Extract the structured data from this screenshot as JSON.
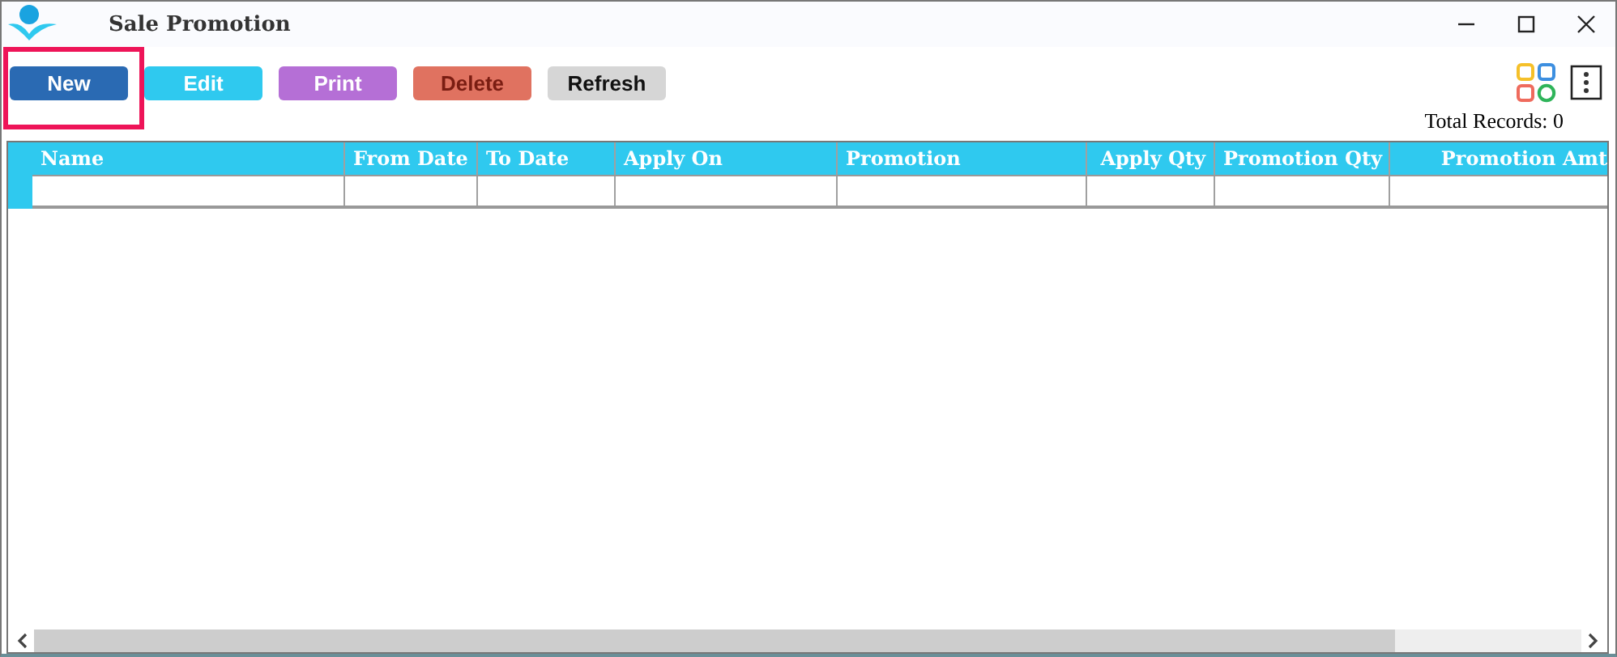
{
  "window": {
    "title": "Sale Promotion"
  },
  "toolbar": {
    "buttons": [
      {
        "label": "New",
        "kind": "primary",
        "highlighted": true
      },
      {
        "label": "Edit",
        "kind": "info",
        "highlighted": false
      },
      {
        "label": "Print",
        "kind": "purple",
        "highlighted": false
      },
      {
        "label": "Delete",
        "kind": "danger",
        "highlighted": false
      },
      {
        "label": "Refresh",
        "kind": "neutral",
        "highlighted": false
      }
    ]
  },
  "total_records": "Total Records: 0",
  "table": {
    "columns": [
      {
        "label": "Name"
      },
      {
        "label": "From Date"
      },
      {
        "label": "To Date"
      },
      {
        "label": "Apply On"
      },
      {
        "label": "Promotion"
      },
      {
        "label": "Apply Qty"
      },
      {
        "label": "Promotion Qty"
      },
      {
        "label": "Promotion Amt"
      }
    ]
  }
}
